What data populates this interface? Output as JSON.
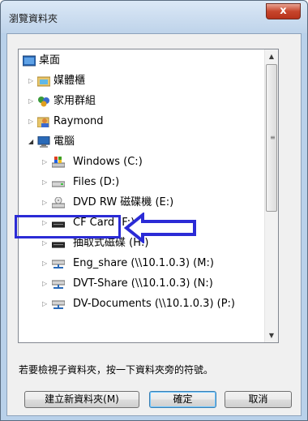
{
  "window": {
    "title": "瀏覽資料夾",
    "close_label": "x"
  },
  "tree": {
    "items": [
      {
        "label": "桌面",
        "icon": "desktop-icon",
        "has_arrow": false
      },
      {
        "label": "媒體櫃",
        "icon": "library-icon",
        "has_arrow": true
      },
      {
        "label": "家用群組",
        "icon": "homegroup-icon",
        "has_arrow": true
      },
      {
        "label": "Raymond",
        "icon": "user-folder-icon",
        "has_arrow": true
      },
      {
        "label": "電腦",
        "icon": "computer-icon",
        "has_arrow": true,
        "expanded": true
      },
      {
        "label": "Windows (C:)",
        "icon": "system-drive-icon",
        "has_arrow": true
      },
      {
        "label": "Files (D:)",
        "icon": "drive-icon",
        "has_arrow": true
      },
      {
        "label": "DVD RW 磁碟機 (E:)",
        "icon": "dvd-drive-icon",
        "has_arrow": true
      },
      {
        "label": "CF Card (F:)",
        "icon": "card-drive-icon",
        "has_arrow": true,
        "highlighted": true
      },
      {
        "label": "抽取式磁碟 (H:)",
        "icon": "removable-drive-icon",
        "has_arrow": true
      },
      {
        "label": "Eng_share (\\\\10.1.0.3) (M:)",
        "icon": "network-drive-icon",
        "has_arrow": true
      },
      {
        "label": "DVT-Share (\\\\10.1.0.3) (N:)",
        "icon": "network-drive-icon",
        "has_arrow": true
      },
      {
        "label": "DV-Documents (\\\\10.1.0.3) (P:)",
        "icon": "network-drive-icon",
        "has_arrow": true
      }
    ]
  },
  "hint": "若要檢視子資料夾，按一下資料夾旁的符號。",
  "buttons": {
    "new_folder": "建立新資料夾(M)",
    "ok": "確定",
    "cancel": "取消"
  },
  "colors": {
    "highlight": "#2b2bd6",
    "title_bg": "#c4d8ee",
    "close_bg": "#c7452c"
  }
}
